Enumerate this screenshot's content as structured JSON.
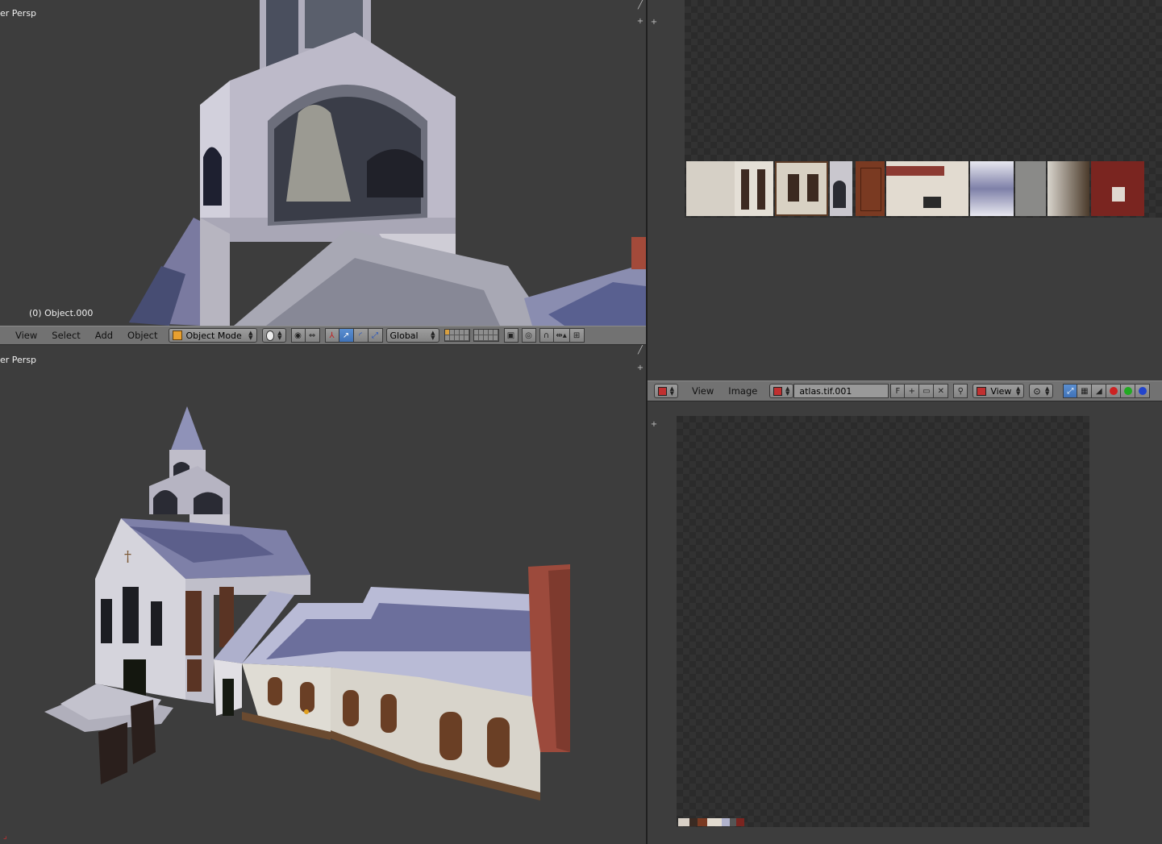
{
  "viewport_top": {
    "view_label": "er Persp",
    "object_info": "(0) Object.000"
  },
  "viewport_bottom": {
    "view_label": "er Persp"
  },
  "view3d_header": {
    "menus": [
      "View",
      "Select",
      "Add",
      "Object"
    ],
    "mode": "Object Mode",
    "orientation": "Global"
  },
  "image_header": {
    "menus": [
      "View",
      "Image"
    ],
    "image_name": "atlas.tif.001",
    "fake_user": "F",
    "view_mode": "View"
  },
  "icons": [
    "mode-cube-icon",
    "shading-sphere-icon",
    "pivot-icon",
    "manipulator-icon",
    "translate-icon",
    "rotate-icon",
    "scale-icon",
    "render-icon",
    "snap-icon",
    "magnet-icon",
    "proportional-icon",
    "camera-icon",
    "new-icon",
    "open-icon",
    "unlink-icon",
    "pin-icon",
    "image-editor-icon"
  ],
  "colors": {
    "active_blue": "#5b8fd1",
    "channel_red": "#cc2222",
    "channel_green": "#22aa22",
    "channel_blue": "#2244cc",
    "layer_active": "#d9a040"
  }
}
